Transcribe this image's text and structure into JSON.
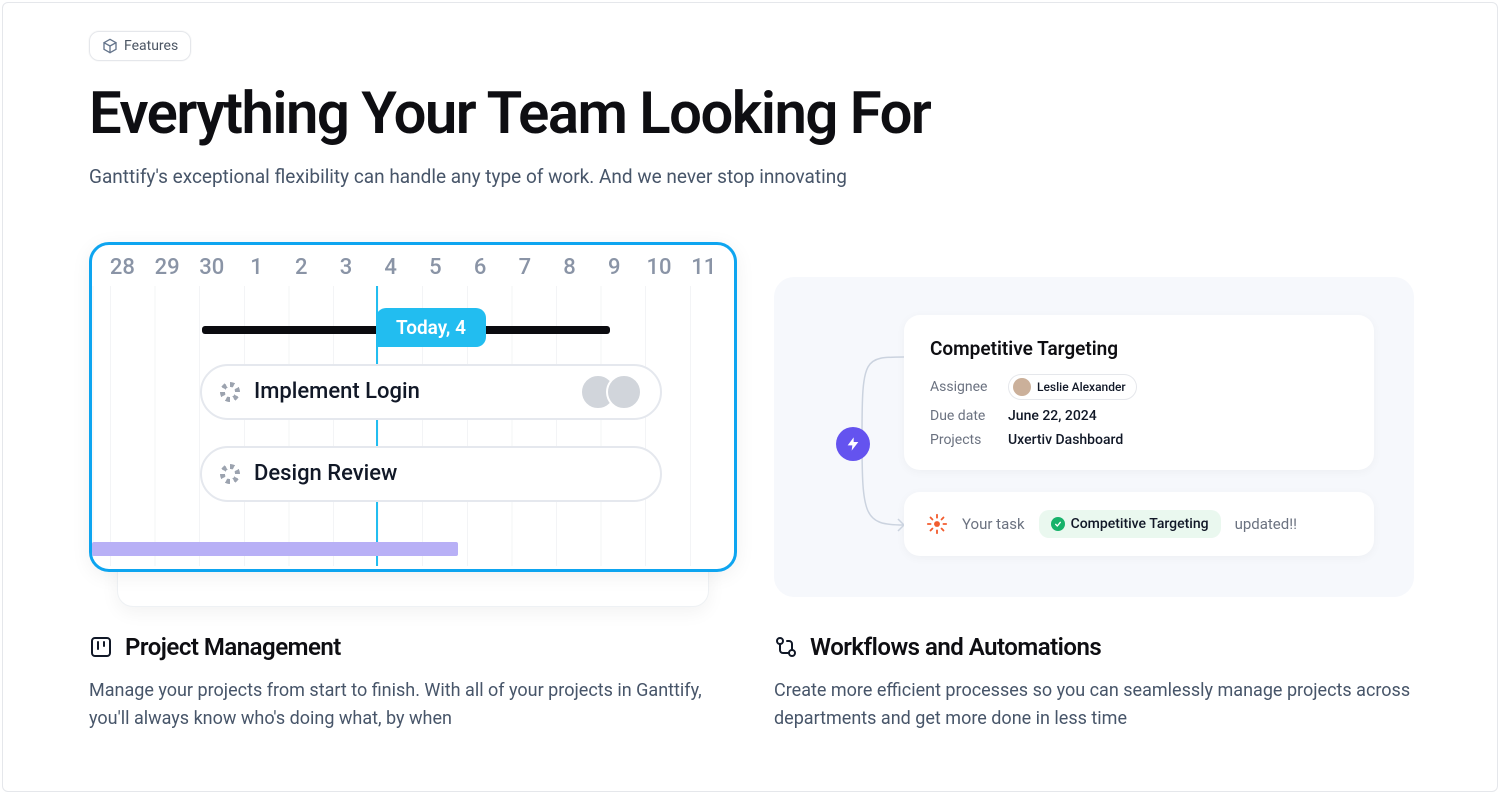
{
  "badge_label": "Features",
  "heading": "Everything Your Team Looking For",
  "subtitle": "Ganttify's exceptional flexibility can handle any type of work. And we never stop innovating",
  "gantt": {
    "dates": [
      "28",
      "29",
      "30",
      "1",
      "2",
      "3",
      "4",
      "5",
      "6",
      "7",
      "8",
      "9",
      "10",
      "11"
    ],
    "today_label": "Today, 4",
    "task1": "Implement Login",
    "task2": "Design Review"
  },
  "workflow": {
    "card_title": "Competitive Targeting",
    "assignee_label": "Assignee",
    "assignee_name": "Leslie Alexander",
    "due_label": "Due date",
    "due_value": "June 22, 2024",
    "projects_label": "Projects",
    "projects_value": "Uxertiv Dashboard",
    "msg_prefix": "Your task",
    "msg_task": "Competitive Targeting",
    "msg_suffix": "updated!!"
  },
  "feature1": {
    "title": "Project Management",
    "desc": "Manage your projects from start to finish. With all of your projects in Ganttify, you'll always know who's doing what, by when"
  },
  "feature2": {
    "title": "Workflows and Automations",
    "desc": "Create more efficient processes so you can seamlessly manage projects across departments and get more done in less time"
  }
}
